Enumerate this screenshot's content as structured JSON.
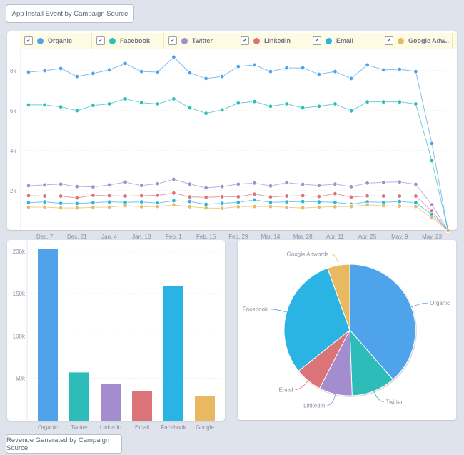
{
  "buttons": {
    "top": "App Install Event by Campaign Source",
    "bottom": "Revenue Generated by Campaign Source"
  },
  "legend": [
    {
      "label": "Organic",
      "color": "#4fa3ea",
      "checked": true
    },
    {
      "label": "Facebook",
      "color": "#2ebcb9",
      "checked": true
    },
    {
      "label": "Twitter",
      "color": "#a38dcf",
      "checked": true
    },
    {
      "label": "LinkedIn",
      "color": "#db7479",
      "checked": true
    },
    {
      "label": "Email",
      "color": "#29b4e3",
      "checked": true
    },
    {
      "label": "Google Adw..",
      "color": "#e8b960",
      "checked": true
    }
  ],
  "chart_data": [
    {
      "type": "line",
      "ylim": [
        0,
        9000
      ],
      "yticks": [
        "2k",
        "4k",
        "6k",
        "8k"
      ],
      "ytick_values": [
        2000,
        4000,
        6000,
        8000
      ],
      "grid": true,
      "legend": "top",
      "xtick_labels": [
        "Dec. 7",
        "Dec. 21",
        "Jan. 4",
        "Jan. 18",
        "Feb. 1",
        "Feb. 15",
        "Feb. 29",
        "Mar. 14",
        "Mar. 28",
        "Apr. 11",
        "Apr. 25",
        "May. 9",
        "May. 23"
      ],
      "series": [
        {
          "name": "Organic",
          "color": "#4fa3ea",
          "values": [
            7930,
            8000,
            8110,
            7710,
            7860,
            8040,
            8360,
            7960,
            7930,
            8680,
            7890,
            7610,
            7710,
            8210,
            8290,
            7960,
            8140,
            8140,
            7820,
            7960,
            7610,
            8290,
            8040,
            8070,
            7960,
            4360,
            0
          ]
        },
        {
          "name": "Facebook",
          "color": "#2ebcb9",
          "values": [
            6290,
            6290,
            6190,
            6000,
            6260,
            6340,
            6590,
            6400,
            6340,
            6590,
            6140,
            5870,
            6040,
            6380,
            6460,
            6220,
            6340,
            6140,
            6220,
            6340,
            5990,
            6440,
            6440,
            6440,
            6340,
            3500,
            0
          ]
        },
        {
          "name": "Twitter",
          "color": "#a38dcf",
          "values": [
            2250,
            2290,
            2330,
            2210,
            2190,
            2290,
            2430,
            2260,
            2350,
            2570,
            2330,
            2140,
            2210,
            2330,
            2380,
            2240,
            2400,
            2320,
            2260,
            2330,
            2200,
            2380,
            2420,
            2440,
            2320,
            1300,
            0
          ]
        },
        {
          "name": "LinkedIn",
          "color": "#db7479",
          "values": [
            1750,
            1730,
            1730,
            1640,
            1770,
            1750,
            1730,
            1750,
            1770,
            1880,
            1690,
            1670,
            1700,
            1700,
            1830,
            1690,
            1730,
            1750,
            1710,
            1850,
            1680,
            1740,
            1730,
            1730,
            1730,
            980,
            0
          ]
        },
        {
          "name": "Email",
          "color": "#29b4e3",
          "values": [
            1400,
            1440,
            1370,
            1360,
            1400,
            1440,
            1420,
            1440,
            1380,
            1500,
            1460,
            1320,
            1370,
            1420,
            1540,
            1420,
            1440,
            1460,
            1440,
            1420,
            1320,
            1440,
            1420,
            1460,
            1400,
            820,
            0
          ]
        },
        {
          "name": "Google Adw..",
          "color": "#e8b960",
          "values": [
            1180,
            1180,
            1140,
            1140,
            1170,
            1180,
            1250,
            1200,
            1210,
            1290,
            1200,
            1140,
            1120,
            1200,
            1210,
            1210,
            1170,
            1140,
            1180,
            1200,
            1210,
            1290,
            1250,
            1230,
            1210,
            650,
            0
          ]
        }
      ]
    },
    {
      "type": "bar",
      "categories": [
        "Organic",
        "Twitter",
        "LinkedIn",
        "Email",
        "Facebook",
        "Google"
      ],
      "values": [
        203000,
        57000,
        43000,
        35000,
        159000,
        29000
      ],
      "colors": [
        "#4fa3ea",
        "#2ebcb9",
        "#a38dcf",
        "#db7479",
        "#29b4e3",
        "#e8b960"
      ],
      "ylim": [
        0,
        213000
      ],
      "yticks": [
        "50k",
        "100k",
        "150k",
        "200k"
      ],
      "ytick_values": [
        50000,
        100000,
        150000,
        200000
      ],
      "grid": true
    },
    {
      "type": "pie",
      "labels": [
        "Organic",
        "Twitter",
        "LinkedIn",
        "Email",
        "Facebook",
        "Google Adwords"
      ],
      "values": [
        203000,
        57000,
        43000,
        35000,
        159000,
        29000
      ],
      "colors": [
        "#4fa3ea",
        "#2ebcb9",
        "#a38dcf",
        "#db7479",
        "#29b4e3",
        "#e8b960"
      ]
    }
  ]
}
